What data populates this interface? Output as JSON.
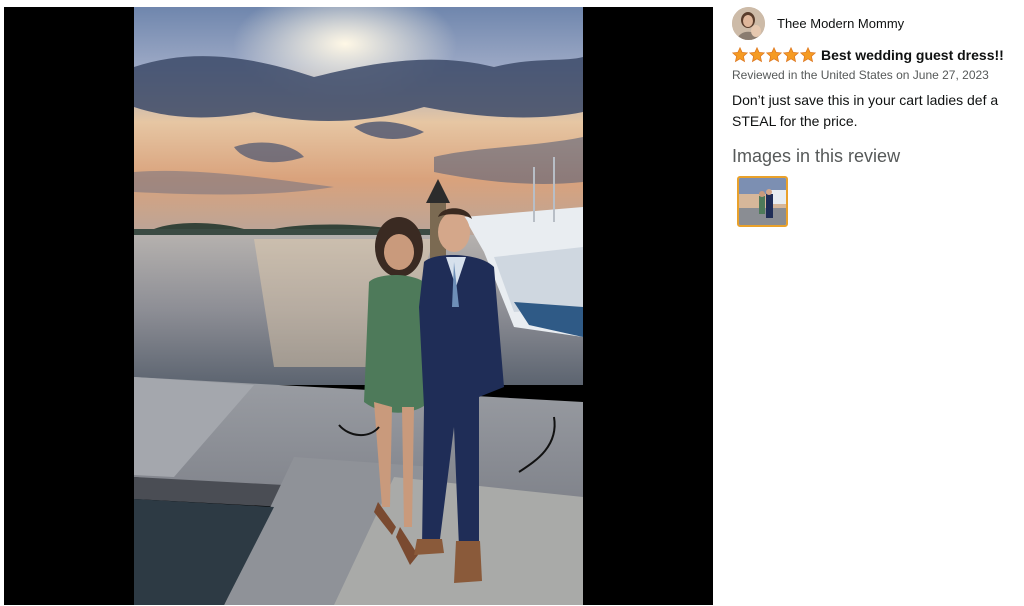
{
  "viewer": {
    "photo_alt": "",
    "colors": {
      "backdrop": "#000000",
      "thumb_border": "#e9a12b"
    }
  },
  "review": {
    "reviewer_name": "Thee Modern Mommy",
    "rating": 5,
    "rating_max": 5,
    "star_color": "#f59b23",
    "title": "Best wedding guest dress!!",
    "date": "Reviewed in the United States on June 27, 2023",
    "body": "Don’t just save this in your cart ladies def a STEAL for the price.",
    "images_heading": "Images in this review",
    "thumbnails": [
      {
        "icon": "review-photo-thumbnail"
      }
    ]
  }
}
